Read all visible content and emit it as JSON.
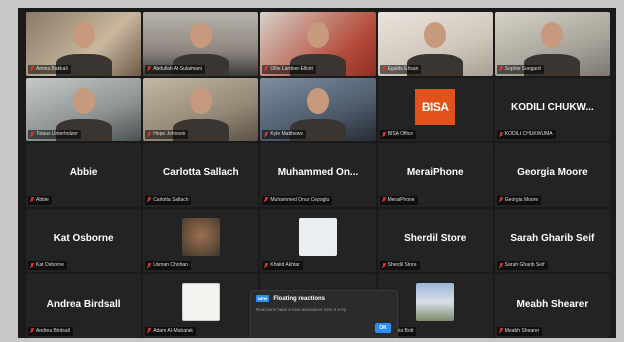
{
  "participants": [
    {
      "tag": "Amina Bakkali",
      "video": "v1",
      "active": true
    },
    {
      "tag": "Abdullah Al-Sulaimani",
      "video": "v2"
    },
    {
      "tag": "Ollie Lardner-Elliott",
      "video": "v3"
    },
    {
      "tag": "Egalds Ehsan",
      "video": "v4"
    },
    {
      "tag": "Sophie Songard",
      "video": "v5"
    },
    {
      "tag": "Tobias Unterholzer",
      "video": "v6"
    },
    {
      "tag": "Hope Johnson",
      "video": "v7"
    },
    {
      "tag": "Kyle Matthews",
      "video": "v8"
    },
    {
      "tag": "BISA Office",
      "logo": "BISA"
    },
    {
      "tag": "KODILI CHUKWUMA",
      "name": "KODILI CHUKW..."
    },
    {
      "tag": "Abbie",
      "name": "Abbie"
    },
    {
      "tag": "Carlotta Sallach",
      "name": "Carlotta Sallach"
    },
    {
      "tag": "Muhammed Onur Cepoglu",
      "name": "Muhammed  On..."
    },
    {
      "tag": "MeraiPhone",
      "name": "MeraiPhone"
    },
    {
      "tag": "Georgia Moore",
      "name": "Georgia Moore"
    },
    {
      "tag": "Kat Osborne",
      "name": "Kat Osborne"
    },
    {
      "tag": "Usman Chohan",
      "thumb": "t-blur"
    },
    {
      "tag": "Khalid Akhtar",
      "thumb": "t-portrait"
    },
    {
      "tag": "Sherdil Store",
      "name": "Sherdil Store"
    },
    {
      "tag": "Sarah Gharib Seif",
      "name": "Sarah Gharib Seif"
    },
    {
      "tag": "Andrea Birdsall",
      "name": "Andrea Birdsall"
    },
    {
      "tag": "Adam Al-Mubarak",
      "thumb": "t-art"
    },
    {
      "tag": "",
      "hidden": true
    },
    {
      "tag": "Sophia Bott",
      "thumb": "t-tree"
    },
    {
      "tag": "Meabh Shearer",
      "name": "Meabh Shearer"
    }
  ],
  "toast": {
    "badge": "NEW",
    "title": "Floating reactions",
    "message": "Reactions have a new animation! Give it a try.",
    "ok_label": "OK"
  },
  "colors": {
    "active_border": "#39c26b",
    "accent": "#2d8cff",
    "bisa": "#e2521d"
  }
}
